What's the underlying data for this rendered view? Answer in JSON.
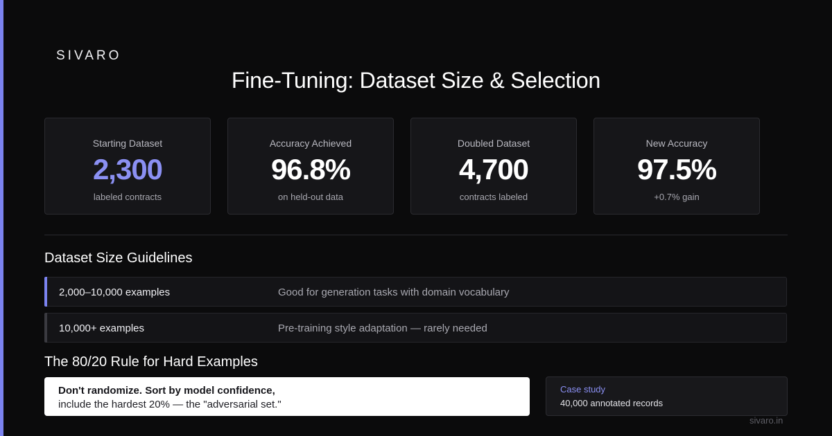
{
  "brand": {
    "logo": "SIVARO",
    "accent_color": "#7b83f0",
    "site": "sivaro.in"
  },
  "title": "Fine-Tuning: Dataset Size & Selection",
  "stats": [
    {
      "label": "Starting Dataset",
      "value": "2,300",
      "sub": "labeled contracts"
    },
    {
      "label": "Accuracy Achieved",
      "value": "96.8%",
      "sub": "on held-out data"
    },
    {
      "label": "Doubled Dataset",
      "value": "4,700",
      "sub": "contracts labeled"
    },
    {
      "label": "New Accuracy",
      "value": "97.5%",
      "sub": "+0.7% gain"
    }
  ],
  "guidelines": {
    "title": "Dataset Size Guidelines",
    "rows": [
      {
        "size": "2,000–10,000 examples",
        "note": "Good for generation tasks with domain vocabulary"
      },
      {
        "size": "10,000+ examples",
        "note": "Pre-training style adaptation — rare­ly needed"
      }
    ]
  },
  "hard_examples": {
    "title": "The 80/20 Rule for Hard Examples",
    "quote_line1": "Don't randomize. Sort by model confidence,",
    "quote_line2": "include the hardest 20% — the \"adversarial set.\""
  },
  "case_study": {
    "label": "Case study",
    "text": "40,000 annotated records"
  }
}
